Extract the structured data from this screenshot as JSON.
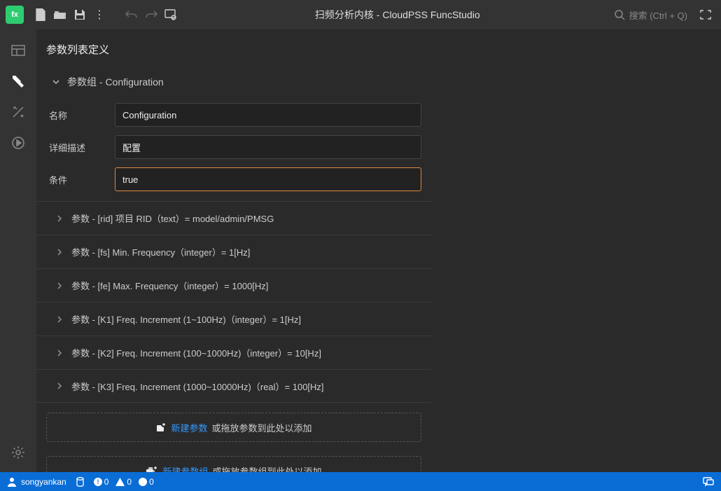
{
  "titlebar": {
    "title": "扫频分析内核 - CloudPSS FuncStudio",
    "search_placeholder": "搜索 (Ctrl + Q)"
  },
  "panel": {
    "title": "参数列表定义",
    "group": {
      "header": "参数组 - Configuration",
      "fields": {
        "name_label": "名称",
        "name_value": "Configuration",
        "desc_label": "详细描述",
        "desc_value": "配置",
        "cond_label": "条件",
        "cond_value": "true"
      }
    },
    "params": [
      "参数 - [rid] 项目 RID（text）= model/admin/PMSG",
      "参数 - [fs] Min. Frequency（integer）= 1[Hz]",
      "参数 - [fe] Max. Frequency（integer）= 1000[Hz]",
      "参数 - [K1] Freq. Increment (1~100Hz)（integer）= 1[Hz]",
      "参数 - [K2] Freq. Increment (100~1000Hz)（integer）= 10[Hz]",
      "参数 - [K3] Freq. Increment (1000~10000Hz)（real）= 100[Hz]"
    ],
    "drop_param": {
      "link": "新建参数",
      "rest": "或拖放参数到此处以添加"
    },
    "drop_group": {
      "link": "新建参数组",
      "rest": "或拖放参数组到此处以添加"
    }
  },
  "status": {
    "user": "songyankan",
    "errors": "0",
    "warnings": "0",
    "infos": "0"
  }
}
